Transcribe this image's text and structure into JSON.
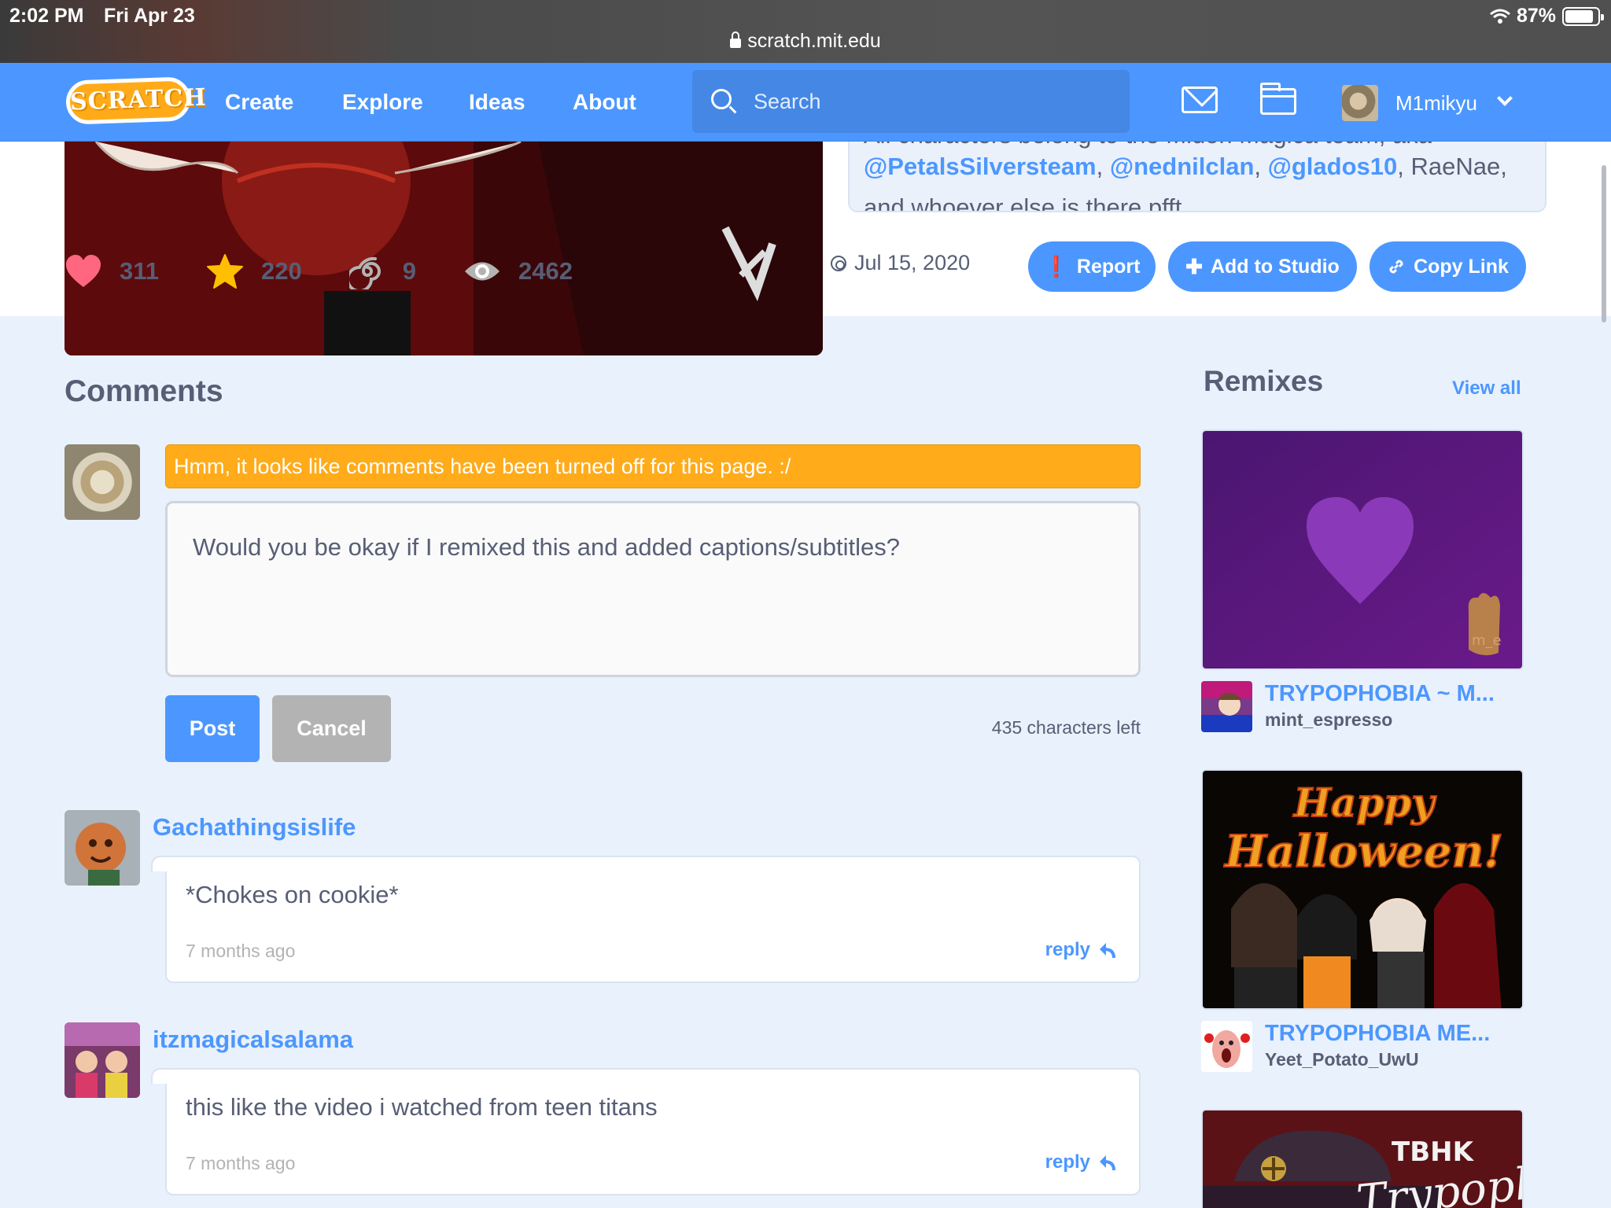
{
  "status_bar": {
    "time": "2:02 PM",
    "date": "Fri Apr 23",
    "url": "scratch.mit.edu",
    "battery": "87%",
    "battery_level": 0.87
  },
  "nav": {
    "logo": "SCRATCH",
    "links": [
      "Create",
      "Explore",
      "Ideas",
      "About"
    ],
    "search_placeholder": "Search",
    "username": "M1mikyu"
  },
  "project": {
    "notes_partial_top": "All characters belong to the Midori Magica team, aka",
    "notes_mentions": [
      "@PetalsSilversteam",
      "@nednilclan",
      "@glados10"
    ],
    "notes_tail": ", RaeNae,",
    "notes_partial_bottom": "and whoever else is there pfft",
    "stats": {
      "loves": "311",
      "favorites": "220",
      "remixes": "9",
      "views": "2462"
    },
    "date": "Jul 15, 2020",
    "buttons": {
      "report": "Report",
      "add_to_studio": "Add to Studio",
      "copy_link": "Copy Link"
    },
    "colors": {
      "accent": "#4c97ff",
      "heart": "#ff6680",
      "star": "#ffbf00",
      "warning": "#ffab1a"
    }
  },
  "comments": {
    "title": "Comments",
    "warning": "Hmm, it looks like comments have been turned off for this page. :/",
    "draft": "Would you be okay if I remixed this and added captions/subtitles?",
    "post_label": "Post",
    "cancel_label": "Cancel",
    "chars_left": "435 characters left",
    "items": [
      {
        "user": "Gachathingsislife",
        "text": "*Chokes on cookie*",
        "time": "7 months ago",
        "reply": "reply"
      },
      {
        "user": "itzmagicalsalama",
        "text": "this like the video i watched from teen titans",
        "time": "7 months ago",
        "reply": "reply"
      }
    ]
  },
  "remixes": {
    "title": "Remixes",
    "view_all": "View all",
    "items": [
      {
        "title": "TRYPOPHOBIA ~ M...",
        "author": "mint_espresso",
        "thumb_signature": "m_e"
      },
      {
        "title": "TRYPOPHOBIA ME...",
        "author": "Yeet_Potato_UwU",
        "thumb_text": [
          "Happy",
          "Halloween!"
        ]
      },
      {
        "title": "",
        "author": "",
        "thumb_text": [
          "TBHK",
          "Trypophobia"
        ]
      }
    ]
  }
}
